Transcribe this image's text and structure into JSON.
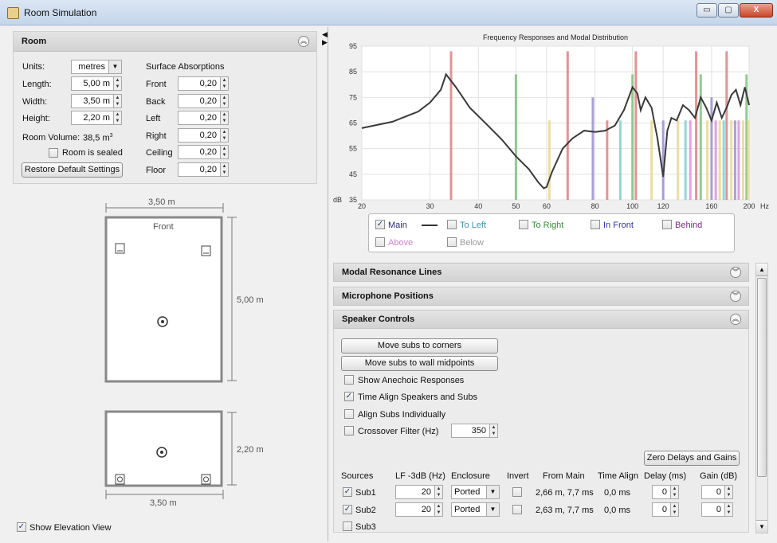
{
  "window": {
    "title": "Room Simulation",
    "btn_min": "▭",
    "btn_max": "▢",
    "btn_close": "X"
  },
  "room": {
    "title": "Room",
    "units_label": "Units:",
    "units_value": "metres",
    "length_label": "Length:",
    "length_value": "5,00 m",
    "width_label": "Width:",
    "width_value": "3,50 m",
    "height_label": "Height:",
    "height_value": "2,20 m",
    "volume_label": "Room Volume:",
    "volume_value": "38,5 m",
    "volume_unit_sup": "3",
    "sealed_label": "Room is sealed",
    "restore_label": "Restore Default Settings",
    "abs_title": "Surface Absorptions",
    "surfaces": [
      {
        "label": "Front",
        "value": "0,20"
      },
      {
        "label": "Back",
        "value": "0,20"
      },
      {
        "label": "Left",
        "value": "0,20"
      },
      {
        "label": "Right",
        "value": "0,20"
      },
      {
        "label": "Ceiling",
        "value": "0,20"
      },
      {
        "label": "Floor",
        "value": "0,20"
      }
    ]
  },
  "plan": {
    "width_dim": "3,50 m",
    "depth_dim": "5,00 m",
    "front_label": "Front",
    "height_dim": "2,20 m",
    "elev_width_dim": "3,50 m",
    "show_elevation_label": "Show Elevation View",
    "show_elevation_checked": true
  },
  "chart_data": {
    "type": "line",
    "title": "Frequency Responses and Modal Distribution",
    "ylabel": "dB",
    "xlabel": "Hz",
    "x_scale": "log",
    "xlim": [
      20,
      200
    ],
    "ylim": [
      35,
      95
    ],
    "x_ticks": [
      20,
      30,
      40,
      50,
      60,
      80,
      100,
      120,
      160,
      200
    ],
    "y_ticks": [
      35,
      45,
      55,
      65,
      75,
      85,
      95
    ],
    "grid": true,
    "series": [
      {
        "name": "Main",
        "x": [
          20,
          24,
          28,
          30,
          32,
          33,
          35,
          38,
          42,
          46,
          50,
          54,
          57,
          59,
          60,
          62,
          66,
          70,
          75,
          80,
          85,
          90,
          95,
          100,
          103,
          105,
          108,
          112,
          116,
          120,
          123,
          126,
          130,
          135,
          140,
          145,
          150,
          155,
          160,
          165,
          170,
          175,
          180,
          185,
          190,
          195,
          200
        ],
        "y": [
          63,
          65.5,
          69.5,
          73,
          78,
          84,
          79,
          71,
          64.5,
          58.5,
          52,
          47,
          42,
          39.5,
          40,
          46,
          55,
          59,
          62,
          61.5,
          62,
          64,
          70,
          79,
          76.5,
          70,
          75,
          71,
          59,
          44,
          62,
          67,
          66,
          72,
          70,
          67,
          75,
          71,
          66,
          73,
          67,
          71,
          76,
          78,
          72,
          79,
          72
        ]
      }
    ],
    "modal_lines": [
      {
        "x": 34,
        "h": 93,
        "color": "#e08080"
      },
      {
        "x": 50,
        "h": 84,
        "color": "#7fc27f"
      },
      {
        "x": 61,
        "h": 66,
        "color": "#e8d890"
      },
      {
        "x": 68,
        "h": 93,
        "color": "#e08080"
      },
      {
        "x": 79,
        "h": 75,
        "color": "#9b8fd0"
      },
      {
        "x": 86,
        "h": 66,
        "color": "#e08080"
      },
      {
        "x": 93,
        "h": 66,
        "color": "#7fd0d0"
      },
      {
        "x": 100,
        "h": 84,
        "color": "#7fc27f"
      },
      {
        "x": 102,
        "h": 93,
        "color": "#e08080"
      },
      {
        "x": 112,
        "h": 66,
        "color": "#e8d890"
      },
      {
        "x": 120,
        "h": 66,
        "color": "#9b8fd0"
      },
      {
        "x": 131,
        "h": 66,
        "color": "#e8d890"
      },
      {
        "x": 137,
        "h": 66,
        "color": "#7fd0d0"
      },
      {
        "x": 141,
        "h": 66,
        "color": "#e08fe0"
      },
      {
        "x": 146,
        "h": 93,
        "color": "#e08080"
      },
      {
        "x": 150,
        "h": 84,
        "color": "#7fc27f"
      },
      {
        "x": 156,
        "h": 66,
        "color": "#e8d890"
      },
      {
        "x": 160,
        "h": 75,
        "color": "#9b8fd0"
      },
      {
        "x": 164,
        "h": 66,
        "color": "#e08fe0"
      },
      {
        "x": 168,
        "h": 66,
        "color": "#e8d890"
      },
      {
        "x": 172,
        "h": 66,
        "color": "#7fd0d0"
      },
      {
        "x": 175,
        "h": 93,
        "color": "#e08080"
      },
      {
        "x": 180,
        "h": 66,
        "color": "#e8d890"
      },
      {
        "x": 184,
        "h": 66,
        "color": "#9b8fd0"
      },
      {
        "x": 188,
        "h": 66,
        "color": "#e08fe0"
      },
      {
        "x": 193,
        "h": 66,
        "color": "#e8d890"
      },
      {
        "x": 197,
        "h": 84,
        "color": "#7fc27f"
      },
      {
        "x": 199,
        "h": 66,
        "color": "#e8d890"
      }
    ]
  },
  "legend": [
    {
      "label": "Main",
      "checked": true,
      "color": "#2a2a7a"
    },
    {
      "label": "To Left",
      "checked": false,
      "color": "#3d8fb0"
    },
    {
      "label": "To Right",
      "checked": false,
      "color": "#3a8a3a"
    },
    {
      "label": "In Front",
      "checked": false,
      "color": "#3535a0"
    },
    {
      "label": "Behind",
      "checked": false,
      "color": "#7a2a7a"
    },
    {
      "label": "Above",
      "checked": false,
      "color": "#d67fd6"
    },
    {
      "label": "Below",
      "checked": false,
      "color": "#9a9a9a"
    }
  ],
  "sections": {
    "modal": "Modal Resonance Lines",
    "mic": "Microphone Positions",
    "speaker": "Speaker Controls"
  },
  "speaker": {
    "move_corners": "Move subs to corners",
    "move_mid": "Move subs to wall midpoints",
    "opt_anechoic": "Show Anechoic Responses",
    "opt_time_align": "Time Align Speakers and Subs",
    "opt_align_ind": "Align Subs Individually",
    "opt_crossover": "Crossover Filter (Hz)",
    "crossover_value": "350",
    "zero_btn": "Zero Delays and Gains",
    "headers": [
      "Sources",
      "LF -3dB (Hz)",
      "Enclosure",
      "Invert",
      "From Main",
      "Time Align",
      "Delay (ms)",
      "Gain (dB)"
    ],
    "rows": [
      {
        "name": "Sub1",
        "checked": true,
        "lf": "20",
        "enclosure": "Ported",
        "from_main": "2,66 m, 7,7 ms",
        "time_align": "0,0 ms",
        "delay": "0",
        "gain": "0"
      },
      {
        "name": "Sub2",
        "checked": true,
        "lf": "20",
        "enclosure": "Ported",
        "from_main": "2,63 m, 7,7 ms",
        "time_align": "0,0 ms",
        "delay": "0",
        "gain": "0"
      },
      {
        "name": "Sub3",
        "checked": false
      }
    ]
  }
}
